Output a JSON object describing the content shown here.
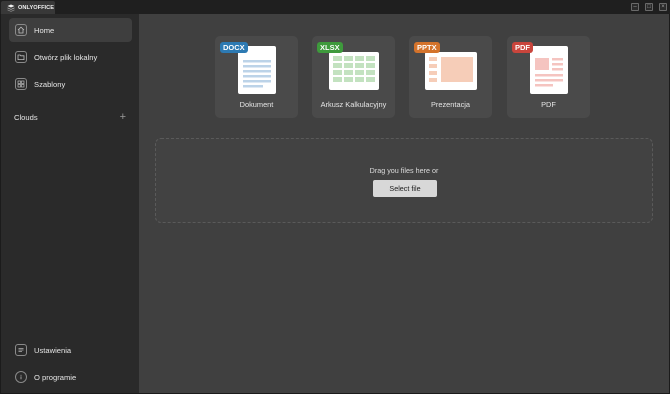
{
  "app": {
    "brand": "ONLYOFFICE"
  },
  "window_controls": {
    "minimize": "–",
    "maximize": "□",
    "close": "×"
  },
  "sidebar": {
    "items": [
      {
        "label": "Home",
        "icon": "home-icon",
        "active": true
      },
      {
        "label": "Otwórz plik lokalny",
        "icon": "folder-icon",
        "active": false
      },
      {
        "label": "Szablony",
        "icon": "templates-grid-icon",
        "active": false
      }
    ],
    "clouds_label": "Clouds",
    "clouds_add": "+",
    "bottom_items": [
      {
        "label": "Ustawienia",
        "icon": "settings-icon"
      },
      {
        "label": "O programie",
        "icon": "info-icon"
      }
    ]
  },
  "new_documents": [
    {
      "label": "Dokument",
      "badge": "DOCX",
      "badge_color": "#2d7ab3"
    },
    {
      "label": "Arkusz Kalkulacyjny",
      "badge": "XLSX",
      "badge_color": "#3e9a3c"
    },
    {
      "label": "Prezentacja",
      "badge": "PPTX",
      "badge_color": "#d4732b"
    },
    {
      "label": "PDF",
      "badge": "PDF",
      "badge_color": "#c9453c"
    }
  ],
  "dropzone": {
    "text": "Drag you files here or",
    "button_label": "Select file"
  }
}
